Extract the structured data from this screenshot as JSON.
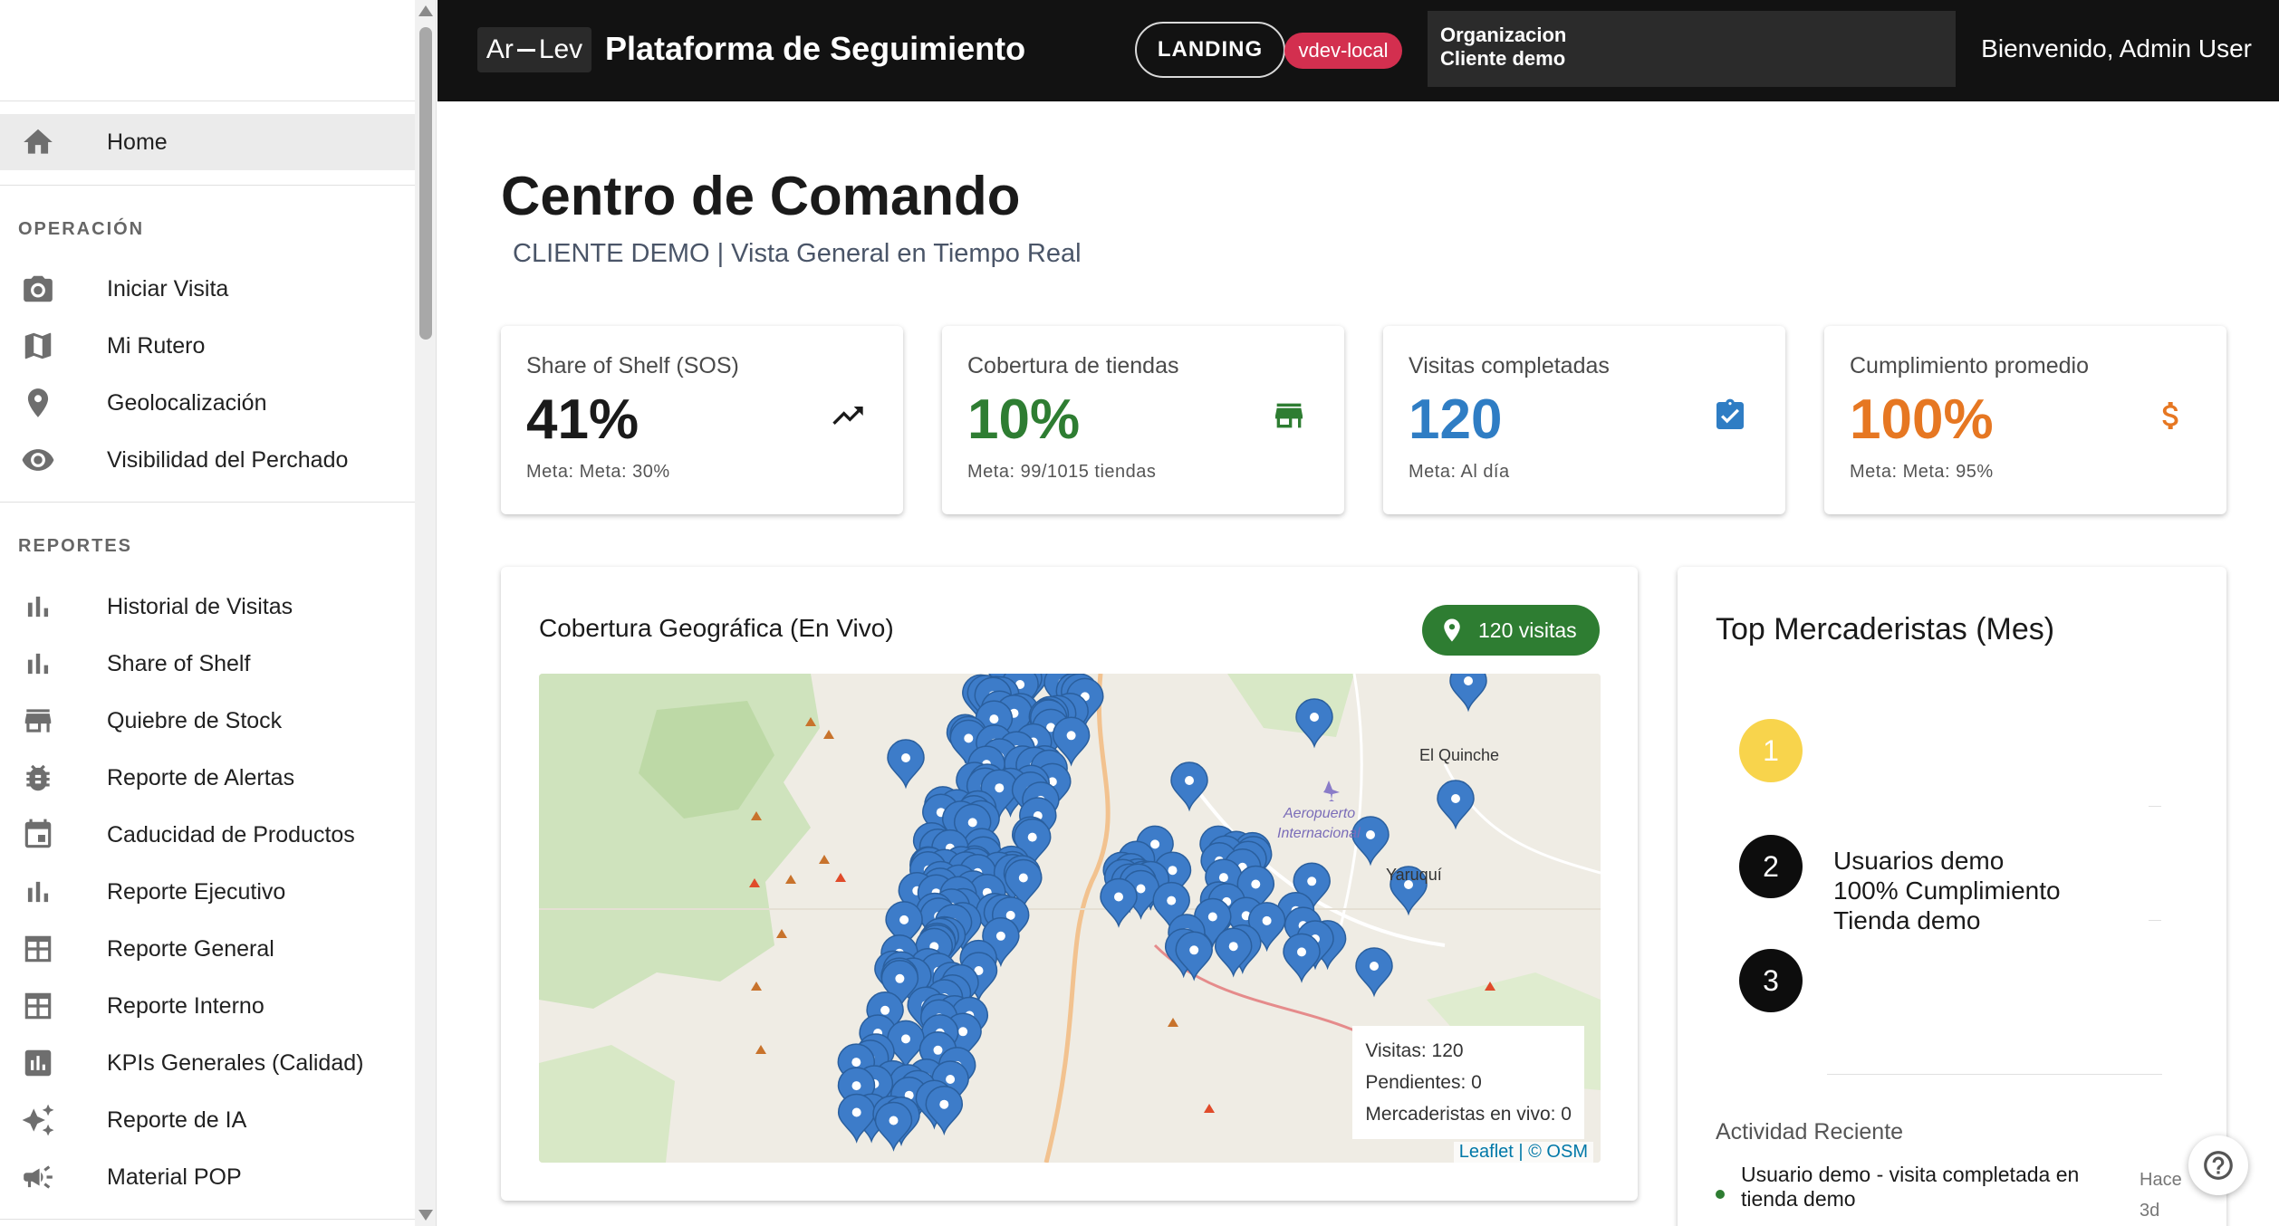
{
  "header": {
    "logo_left": "Ar",
    "logo_right": "Lev",
    "title": "Plataforma de Seguimiento",
    "landing_label": "LANDING",
    "env_label": "vdev-local",
    "org_line1": "Organizacion",
    "org_line2": "Cliente demo",
    "welcome": "Bienvenido, Admin User"
  },
  "sidebar": {
    "home_label": "Home",
    "section_operacion": "OPERACIÓN",
    "operacion_items": [
      {
        "label": "Iniciar Visita",
        "icon": "camera-icon"
      },
      {
        "label": "Mi Rutero",
        "icon": "map-icon"
      },
      {
        "label": "Geolocalización",
        "icon": "location-pin-icon"
      },
      {
        "label": "Visibilidad del Perchado",
        "icon": "eye-icon"
      }
    ],
    "section_reportes": "REPORTES",
    "reportes_items": [
      {
        "label": "Historial de Visitas",
        "icon": "bar-chart-icon"
      },
      {
        "label": "Share of Shelf",
        "icon": "bar-chart-icon"
      },
      {
        "label": "Quiebre de Stock",
        "icon": "store-icon"
      },
      {
        "label": "Reporte de Alertas",
        "icon": "bug-icon"
      },
      {
        "label": "Caducidad de Productos",
        "icon": "calendar-icon"
      },
      {
        "label": "Reporte Ejecutivo",
        "icon": "bar-chart-icon"
      },
      {
        "label": "Reporte General",
        "icon": "table-icon"
      },
      {
        "label": "Reporte Interno",
        "icon": "table-icon"
      },
      {
        "label": "KPIs Generales (Calidad)",
        "icon": "analytics-icon"
      },
      {
        "label": "Reporte de IA",
        "icon": "sparkle-icon"
      },
      {
        "label": "Material POP",
        "icon": "megaphone-icon"
      }
    ]
  },
  "main": {
    "title": "Centro de Comando",
    "subtitle": "CLIENTE DEMO | Vista General en Tiempo Real"
  },
  "kpis": [
    {
      "label": "Share of Shelf (SOS)",
      "value": "41%",
      "meta": "Meta: Meta: 30%",
      "color": "#1a1a1a",
      "icon": "trending-up-icon"
    },
    {
      "label": "Cobertura de tiendas",
      "value": "10%",
      "meta": "Meta: 99/1015 tiendas",
      "color": "#2e7d32",
      "icon": "store-icon"
    },
    {
      "label": "Visitas completadas",
      "value": "120",
      "meta": "Meta: Al día",
      "color": "#2f7dc4",
      "icon": "clipboard-check-icon"
    },
    {
      "label": "Cumplimiento promedio",
      "value": "100%",
      "meta": "Meta: Meta: 95%",
      "color": "#e67722",
      "icon": "dollar-icon"
    }
  ],
  "map": {
    "title": "Cobertura Geográfica (En Vivo)",
    "visits_pill": "120 visitas",
    "place_el_quinche": "El Quinche",
    "place_airport_1": "Aeropuerto",
    "place_airport_2": "Internacional",
    "place_yaruqui": "Yaruquí",
    "stats_visitas": "Visitas: 120",
    "stats_pendientes": "Pendientes: 0",
    "stats_mercaderistas": "Mercaderistas en vivo: 0",
    "attribution": "Leaflet | © OSM",
    "marker_color": "#3d7cc9"
  },
  "top_mercaderistas": {
    "title": "Top Mercaderistas (Mes)",
    "ranks": [
      "1",
      "2",
      "3"
    ],
    "entry_line1": "Usuarios demo",
    "entry_line2": "100% Cumplimiento",
    "entry_line3": "Tienda demo"
  },
  "activity": {
    "title": "Actividad Reciente",
    "item_text": "Usuario demo - visita completada en tienda demo",
    "item_time_1": "Hace",
    "item_time_2": "3d"
  }
}
